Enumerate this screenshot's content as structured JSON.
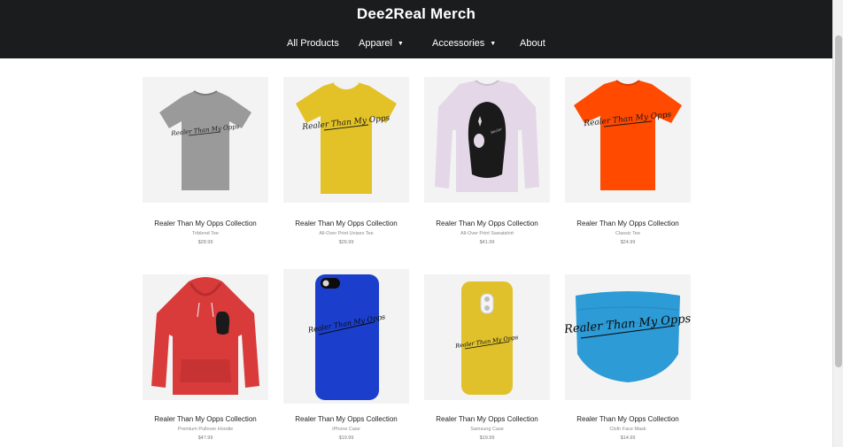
{
  "store": {
    "title": "Dee2Real Merch"
  },
  "nav": {
    "items": [
      {
        "label": "All Products",
        "dropdown": false
      },
      {
        "label": "Apparel",
        "dropdown": true
      },
      {
        "label": "Accessories",
        "dropdown": true
      },
      {
        "label": "About",
        "dropdown": false
      }
    ]
  },
  "products": [
    {
      "title": "Realer Than My Opps Collection",
      "type": "Triblend Tee",
      "price": "$28.99",
      "image": "tshirt-gray",
      "color": "#9a9a9a"
    },
    {
      "title": "Realer Than My Opps Collection",
      "type": "All-Over Print Unisex Tee",
      "price": "$26.99",
      "image": "tshirt-yellow",
      "color": "#e3c227"
    },
    {
      "title": "Realer Than My Opps Collection",
      "type": "All-Over Print Sweatshirt",
      "price": "$41.99",
      "image": "sweatshirt-ski-mask",
      "color": "#e4d8e8"
    },
    {
      "title": "Realer Than My Opps Collection",
      "type": "Classic Tee",
      "price": "$24.99",
      "image": "tshirt-orange",
      "color": "#ff4a00"
    },
    {
      "title": "Realer Than My Opps Collection",
      "type": "Premium Pullover Hoodie",
      "price": "$47.99",
      "image": "hoodie-red",
      "color": "#d93a3a"
    },
    {
      "title": "Realer Than My Opps Collection",
      "type": "iPhone Case",
      "price": "$19.99",
      "image": "iphone-case-blue",
      "color": "#1b3fcc"
    },
    {
      "title": "Realer Than My Opps Collection",
      "type": "Samsung Case",
      "price": "$19.99",
      "image": "samsung-case-yellow",
      "color": "#e0c12b"
    },
    {
      "title": "Realer Than My Opps Collection",
      "type": "Cloth Face Mask",
      "price": "$14.99",
      "image": "face-mask-blue",
      "color": "#2d9bd6"
    }
  ]
}
